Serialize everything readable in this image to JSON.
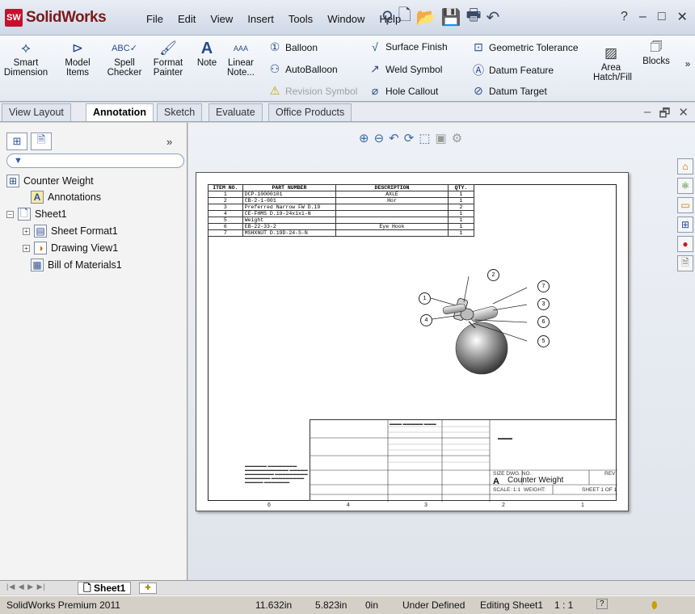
{
  "app": {
    "name": "SolidWorks",
    "badge": "SW"
  },
  "menu": [
    "File",
    "Edit",
    "View",
    "Insert",
    "Tools",
    "Window",
    "Help"
  ],
  "quick_access": [
    "pushpin-icon",
    "new-document-icon",
    "open-icon",
    "save-icon",
    "print-icon",
    "undo-icon",
    "help-icon"
  ],
  "window_controls": {
    "minimize": "–",
    "restore": "□",
    "close": "✕",
    "help": "?"
  },
  "ribbon": {
    "smart_dimension": "Smart Dimension",
    "model_items": "Model Items",
    "spell_checker": "Spell Checker",
    "format_painter": "Format Painter",
    "note": "Note",
    "linear_note": "Linear Note...",
    "balloon": "Balloon",
    "autoballoon": "AutoBalloon",
    "revision_symbol": "Revision Symbol",
    "surface_finish": "Surface Finish",
    "weld_symbol": "Weld Symbol",
    "hole_callout": "Hole Callout",
    "geometric_tolerance": "Geometric Tolerance",
    "datum_feature": "Datum Feature",
    "datum_target": "Datum Target",
    "area_hatch": "Area Hatch/Fill",
    "blocks": "Blocks",
    "expand": "»"
  },
  "tabs": [
    "View Layout",
    "Annotation",
    "Sketch",
    "Evaluate",
    "Office Products"
  ],
  "active_tab": "Annotation",
  "feature_tree": {
    "filter_symbol": "▼",
    "items": [
      "Counter Weight",
      "Annotations",
      "Sheet1",
      "Sheet Format1",
      "Drawing View1",
      "Bill of Materials1"
    ],
    "collapse": "»"
  },
  "bom": {
    "headers": [
      "ITEM NO.",
      "PART NUMBER",
      "DESCRIPTION",
      "QTY."
    ],
    "rows": [
      [
        "1",
        "DCP-10000101",
        "AXLE",
        "1"
      ],
      [
        "2",
        "CB-2-1-001",
        "Hor",
        "1"
      ],
      [
        "3",
        "Preferred Narrow FW D.19",
        "",
        "2"
      ],
      [
        "4",
        "CE-FHMS D.19-24x1x1-N",
        "",
        "1"
      ],
      [
        "5",
        "Weight",
        "",
        "1"
      ],
      [
        "6",
        "EB-22-33-2",
        "Eye Hook",
        "1"
      ],
      [
        "7",
        "MSHXNUT D.19D-24-S-N",
        "",
        "1"
      ]
    ]
  },
  "balloons": [
    "1",
    "2",
    "3",
    "4",
    "5",
    "6",
    "7"
  ],
  "zones_bottom": [
    "6",
    "4",
    "3",
    "2",
    "1"
  ],
  "title_block": {
    "size_label": "SIZE DWG. NO.",
    "rev_label": "REV",
    "size": "A",
    "title": "Counter Weight",
    "scale": "SCALE: 1:1",
    "weight": "WEIGHT:",
    "sheet": "SHEET 1 OF 1"
  },
  "sheet_tab": "Sheet1",
  "status": {
    "product": "SolidWorks Premium 2011",
    "x": "11.632in",
    "y": "5.823in",
    "z": "0in",
    "state": "Under Defined",
    "editing": "Editing Sheet1",
    "scale": "1 : 1"
  }
}
